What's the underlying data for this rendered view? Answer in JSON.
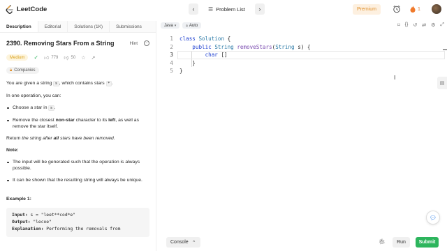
{
  "header": {
    "logo_text": "LeetCode",
    "prev_icon": "‹",
    "next_icon": "›",
    "problem_list_label": "Problem List",
    "premium_label": "Premium",
    "streak_count": "1"
  },
  "tabs": [
    {
      "label": "Description"
    },
    {
      "label": "Editorial"
    },
    {
      "label": "Solutions (1K)"
    },
    {
      "label": "Submissions"
    }
  ],
  "problem": {
    "title": "2390. Removing Stars From a String",
    "hint_label": "Hint",
    "difficulty": "Medium",
    "likes": "779",
    "dislikes": "50",
    "companies_label": "Companies",
    "p1_pre": "You are given a string ",
    "p1_code1": "s",
    "p1_mid": ", which contains stars ",
    "p1_code2": "*",
    "p1_post": ".",
    "p2": "In one operation, you can:",
    "b1_pre": "Choose a star in ",
    "b1_code": "s",
    "b1_post": ".",
    "b2_pre": "Remove the closest ",
    "b2_bold1": "non-star",
    "b2_mid": " character to its ",
    "b2_bold2": "left",
    "b2_post": ", as well as remove the star itself.",
    "p3_pre": "Return ",
    "p3_em1": "the string after ",
    "p3_bold": "all",
    "p3_em2": " stars have been removed",
    "p3_post": ".",
    "note_label": "Note:",
    "n1": "The input will be generated such that the operation is always possible.",
    "n2": "It can be shown that the resulting string will always be unique.",
    "example_title": "Example 1:",
    "ex_input_label": "Input:",
    "ex_input_value": " s = \"leet**cod*e\"",
    "ex_output_label": "Output:",
    "ex_output_value": " \"lecoe\"",
    "ex_expl_label": "Explanation:",
    "ex_expl_value": " Performing the removals from"
  },
  "editor": {
    "language": "Java",
    "autocomplete": "Auto",
    "lines": [
      {
        "num": "1",
        "tokens": [
          {
            "t": "class ",
            "c": "kw"
          },
          {
            "t": "Solution",
            "c": "ty"
          },
          {
            "t": " {",
            "c": ""
          }
        ]
      },
      {
        "num": "2",
        "tokens": [
          {
            "t": "    ",
            "c": ""
          },
          {
            "t": "public ",
            "c": "kw"
          },
          {
            "t": "String ",
            "c": "ty"
          },
          {
            "t": "removeStars",
            "c": "fn"
          },
          {
            "t": "(",
            "c": ""
          },
          {
            "t": "String",
            "c": "ty"
          },
          {
            "t": " s) {",
            "c": ""
          }
        ]
      },
      {
        "num": "3",
        "tokens": [
          {
            "t": "        ",
            "c": ""
          },
          {
            "t": "char",
            "c": "kw"
          },
          {
            "t": " []",
            "c": ""
          }
        ]
      },
      {
        "num": "4",
        "tokens": [
          {
            "t": "    }",
            "c": ""
          }
        ]
      },
      {
        "num": "5",
        "tokens": [
          {
            "t": "}",
            "c": ""
          }
        ]
      }
    ]
  },
  "bottom": {
    "console_label": "Console",
    "run_label": "Run",
    "submit_label": "Submit"
  },
  "colors": {
    "accent_green": "#2db55d",
    "premium_orange": "#e0912c",
    "keyword_blue": "#1d3fd1"
  }
}
